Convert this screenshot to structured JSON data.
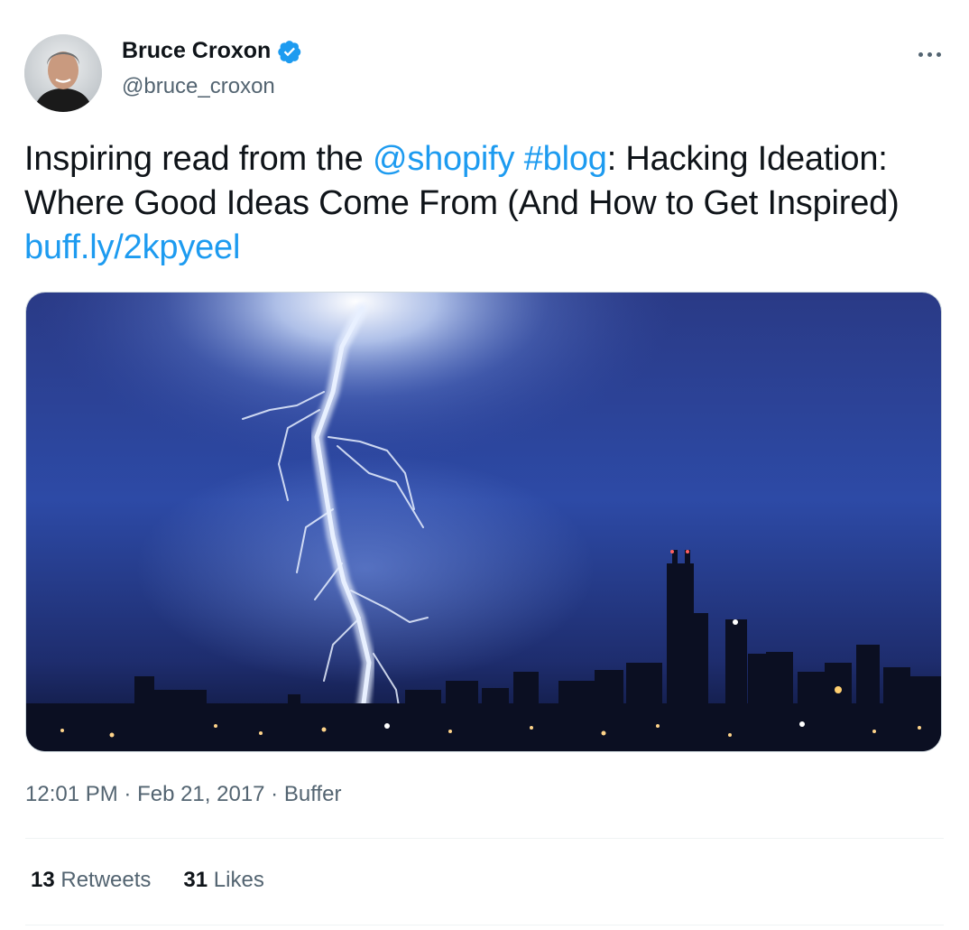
{
  "author": {
    "name": "Bruce Croxon",
    "handle": "@bruce_croxon",
    "verified_icon": "verified-badge-icon",
    "avatar_icon": "profile-photo"
  },
  "menu": {
    "icon": "more-options-icon"
  },
  "tweet": {
    "text_1": "Inspiring read from the ",
    "mention": "@shopify",
    "space": " ",
    "hashtag": "#blog",
    "text_2": ": Hacking Ideation: Where Good Ideas Come From (And How to Get Inspired) ",
    "link": "buff.ly/2kpyeel"
  },
  "media": {
    "description_icon": "lightning-over-city-skyline-photo"
  },
  "meta": {
    "time": "12:01 PM",
    "sep1": " · ",
    "date": "Feb 21, 2017",
    "sep2": " · ",
    "source": "Buffer"
  },
  "stats": {
    "retweets_count": "13",
    "retweets_label": "Retweets",
    "likes_count": "31",
    "likes_label": "Likes"
  },
  "colors": {
    "link": "#1d9bf0",
    "secondary_text": "#536471",
    "primary_text": "#0f1419"
  }
}
